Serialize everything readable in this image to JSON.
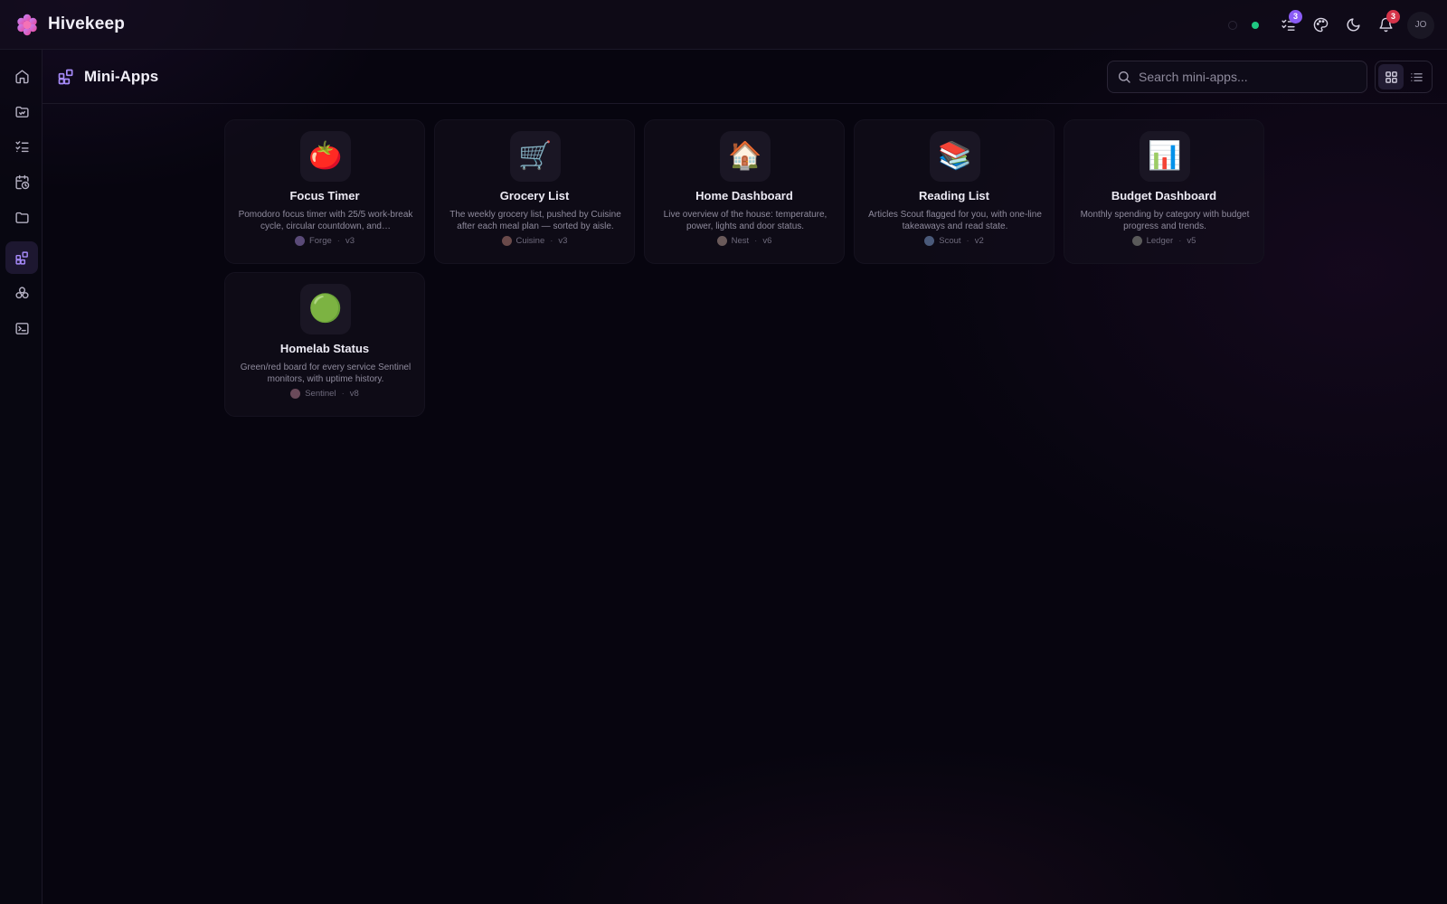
{
  "app": {
    "name": "Hivekeep"
  },
  "topbar": {
    "tasks_badge": "3",
    "notifications_badge": "3",
    "avatar_initials": "JO",
    "colors": {
      "online": "#1fc882",
      "tasks_badge": "#8b5cf6",
      "notifications_badge": "#d6344a"
    },
    "icons": [
      "status-indicator",
      "tasks-icon",
      "palette-icon",
      "moon-icon",
      "bell-icon"
    ]
  },
  "sidebar": {
    "items": [
      {
        "name": "home",
        "icon": "home-icon",
        "active": false
      },
      {
        "name": "inbox",
        "icon": "inbox-icon",
        "active": false
      },
      {
        "name": "tasks",
        "icon": "checklist-icon",
        "active": false
      },
      {
        "name": "schedule",
        "icon": "calendar-clock-icon",
        "active": false
      },
      {
        "name": "files",
        "icon": "folder-icon",
        "active": false
      },
      {
        "name": "mini-apps",
        "icon": "grid-plus-icon",
        "active": true
      },
      {
        "name": "agents",
        "icon": "cluster-icon",
        "active": false
      },
      {
        "name": "terminal",
        "icon": "terminal-icon",
        "active": false
      }
    ]
  },
  "page": {
    "title": "Mini-Apps",
    "search": {
      "placeholder": "Search mini-apps...",
      "value": ""
    },
    "view": "grid"
  },
  "apps": [
    {
      "emoji": "🍅",
      "title": "Focus Timer",
      "description": "Pomodoro focus timer with 25/5 work-break cycle, circular countdown, and…",
      "author": "Forge",
      "version": "v3"
    },
    {
      "emoji": "🛒",
      "title": "Grocery List",
      "description": "The weekly grocery list, pushed by Cuisine after each meal plan — sorted by aisle.",
      "author": "Cuisine",
      "version": "v3"
    },
    {
      "emoji": "🏠",
      "title": "Home Dashboard",
      "description": "Live overview of the house: temperature, power, lights and door status.",
      "author": "Nest",
      "version": "v6"
    },
    {
      "emoji": "📚",
      "title": "Reading List",
      "description": "Articles Scout flagged for you, with one-line takeaways and read state.",
      "author": "Scout",
      "version": "v2"
    },
    {
      "emoji": "📊",
      "title": "Budget Dashboard",
      "description": "Monthly spending by category with budget progress and trends.",
      "author": "Ledger",
      "version": "v5"
    },
    {
      "emoji": "🟢",
      "title": "Homelab Status",
      "description": "Green/red board for every service Sentinel monitors, with uptime history.",
      "author": "Sentinel",
      "version": "v8"
    }
  ]
}
